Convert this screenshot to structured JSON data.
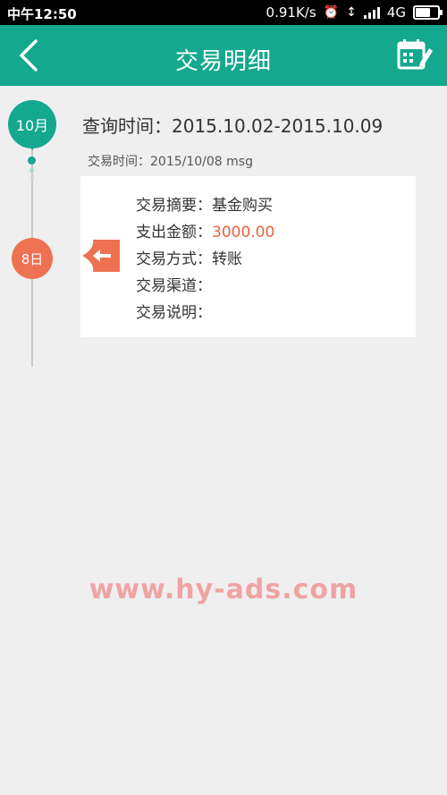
{
  "status_bar": {
    "time": "中午12:50",
    "net_speed": "0.91K/s",
    "network": "4G",
    "icons": [
      "alarm-icon",
      "vibrate-icon",
      "signal-icon",
      "battery-icon"
    ]
  },
  "app_bar": {
    "title": "交易明细",
    "back_icon": "chevron-left-icon",
    "calendar_icon": "calendar-edit-icon",
    "color": "#14a88f"
  },
  "timeline": {
    "month": "10月",
    "day": "8日",
    "month_color": "#14a88f",
    "day_color": "#ee7151"
  },
  "query": {
    "label": "查询时间：2015.10.02-2015.10.09"
  },
  "record": {
    "time_line": "交易时间：2015/10/08  msg",
    "summary_label": "交易摘要：",
    "summary_value": "基金购买",
    "amount_label": "支出金额：",
    "amount_value": "3000.00",
    "method_label": "交易方式：",
    "method_value": "转账",
    "channel_label": "交易渠道：",
    "channel_value": "",
    "note_label": "交易说明：",
    "note_value": "",
    "amount_color": "#e8643f"
  },
  "watermark": "www.hy-ads.com"
}
